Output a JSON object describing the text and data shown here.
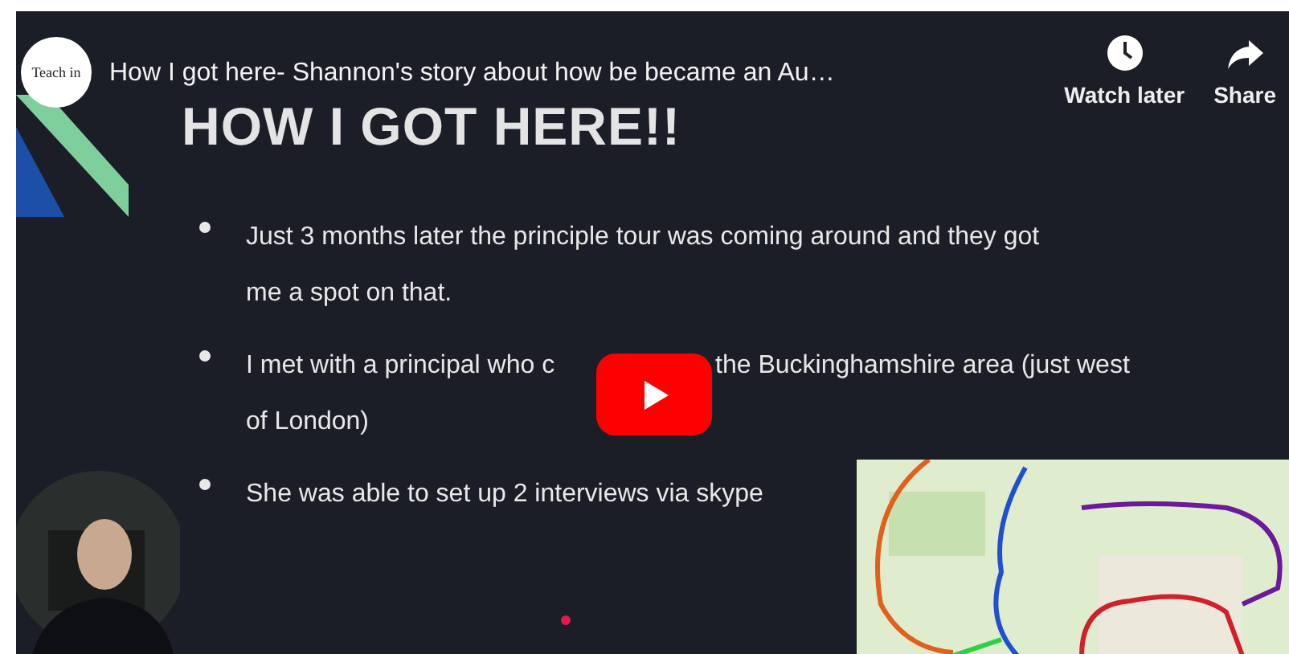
{
  "player": {
    "channel_logo": "Teach in",
    "title": "How I got here- Shannon's story about how be became an Au…",
    "actions": [
      {
        "kind": "watch_later",
        "label": "Watch later"
      },
      {
        "kind": "share",
        "label": "Share"
      }
    ]
  },
  "slide": {
    "heading": "HOW I GOT HERE!!",
    "bullets": [
      {
        "lines": [
          [
            "Just 3 months later the principle tour was coming around and they got"
          ],
          [
            "me a spot on that."
          ]
        ]
      },
      {
        "lines": [
          [
            "I met with a principal who c",
            "the Buckinghamshire area (just west"
          ],
          [
            "of London)"
          ]
        ]
      },
      {
        "lines": [
          [
            "She was able to set up 2 interviews via skype"
          ]
        ]
      }
    ]
  }
}
